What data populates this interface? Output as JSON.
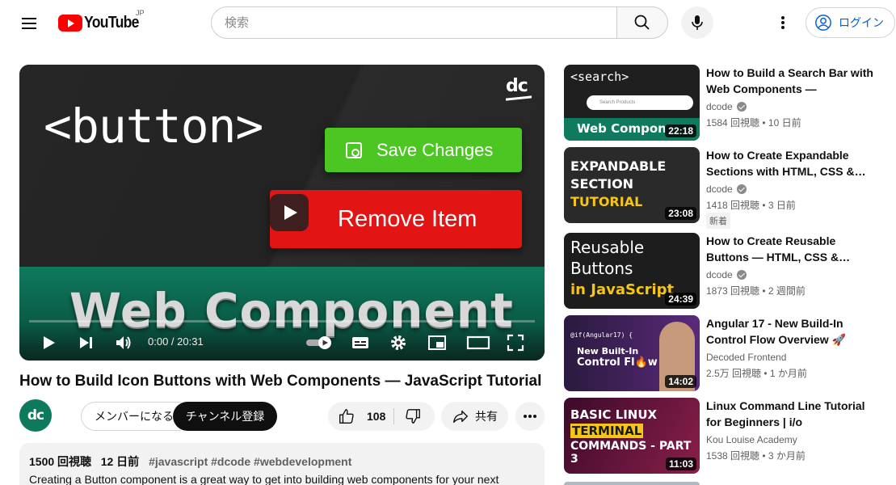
{
  "header": {
    "logo_text": "YouTube",
    "region": "JP",
    "search_placeholder": "検索",
    "login_label": "ログイン"
  },
  "player": {
    "thumb_tag": "<button>",
    "demo_save": "Save Changes",
    "demo_remove": "Remove Item",
    "thumb_footer": "Web Component",
    "channel_mark": "dc",
    "time": "0:00 / 20:31"
  },
  "video": {
    "title": "How to Build Icon Buttons with Web Components — JavaScript Tutorial",
    "channel_avatar": "dc",
    "member_label": "メンバーになる",
    "subscribe_label": "チャンネル登録",
    "likes": "108",
    "share_label": "共有"
  },
  "description": {
    "views": "1500 回視聴",
    "age": "12 日前",
    "tags": "#javascript #dcode #webdevelopment",
    "text": "Creating a Button component is a great way to get into building web components for your next"
  },
  "recommendations": [
    {
      "title": "How to Build a Search Bar with Web Components — JavaScrip…",
      "channel": "dcode",
      "verified": true,
      "stats": "1584 回視聴 • 10 日前",
      "duration": "22:18",
      "thumb_text": "<search>",
      "thumb_sub": "Web Compon",
      "thumb_search_placeholder": "Search Products"
    },
    {
      "title": "How to Create Expandable Sections with HTML, CSS &…",
      "channel": "dcode",
      "verified": true,
      "stats": "1418 回視聴 • 3 日前",
      "badge": "新着",
      "duration": "23:08",
      "thumb_line1": "EXPANDABLE",
      "thumb_line2": "SECTION",
      "thumb_line3": "TUTORIAL"
    },
    {
      "title": "How to Create Reusable Buttons — HTML, CSS &…",
      "channel": "dcode",
      "verified": true,
      "stats": "1873 回視聴 • 2 週間前",
      "duration": "24:39",
      "thumb_line1": "Reusable",
      "thumb_line2": "Buttons",
      "thumb_line3": "in JavaScript"
    },
    {
      "title": "Angular 17 - New Build-In Control Flow Overview 🚀",
      "channel": "Decoded Frontend",
      "verified": false,
      "stats": "2.5万 回視聴 • 1 か月前",
      "duration": "14:02",
      "thumb_code": "@if(Angular17) {",
      "thumb_line1": "New Built-In",
      "thumb_line2": "Control Fl🔥w"
    },
    {
      "title": "Linux Command Line Tutorial for Beginners | i/o Redirection,…",
      "channel": "Kou Louise Academy",
      "verified": false,
      "stats": "1538 回視聴 • 3 か月前",
      "duration": "11:03",
      "thumb_line1": "BASIC LINUX",
      "thumb_line2": "TERMINAL",
      "thumb_line3": "COMMANDS - PART 3"
    }
  ],
  "colors": {
    "brand_red": "#ff0000",
    "link_blue": "#065fd4",
    "save_green": "#4cc622",
    "remove_red": "#e21414",
    "dcode_green": "#0e7a5d"
  }
}
